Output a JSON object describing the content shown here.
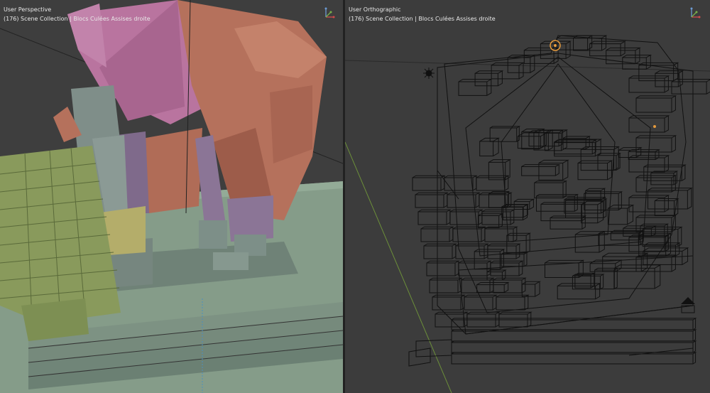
{
  "left_viewport": {
    "view_name": "User Perspective",
    "collection_info": "(176) Scene Collection | Blocs Culées Assises droite"
  },
  "right_viewport": {
    "view_name": "User Orthographic",
    "collection_info": "(176) Scene Collection | Blocs Culées Assises droite"
  },
  "colors": {
    "floor_green": "#7f9a83",
    "roof_pink": "#b9749f",
    "terracotta": "#b5715c",
    "purple_stone": "#8b7596",
    "olive_blocks": "#899a5c",
    "grey_stone": "#7f8e89",
    "yellow_block": "#b4ad6a",
    "wireframe": "#111111",
    "origin_orange": "#e59a3c"
  }
}
